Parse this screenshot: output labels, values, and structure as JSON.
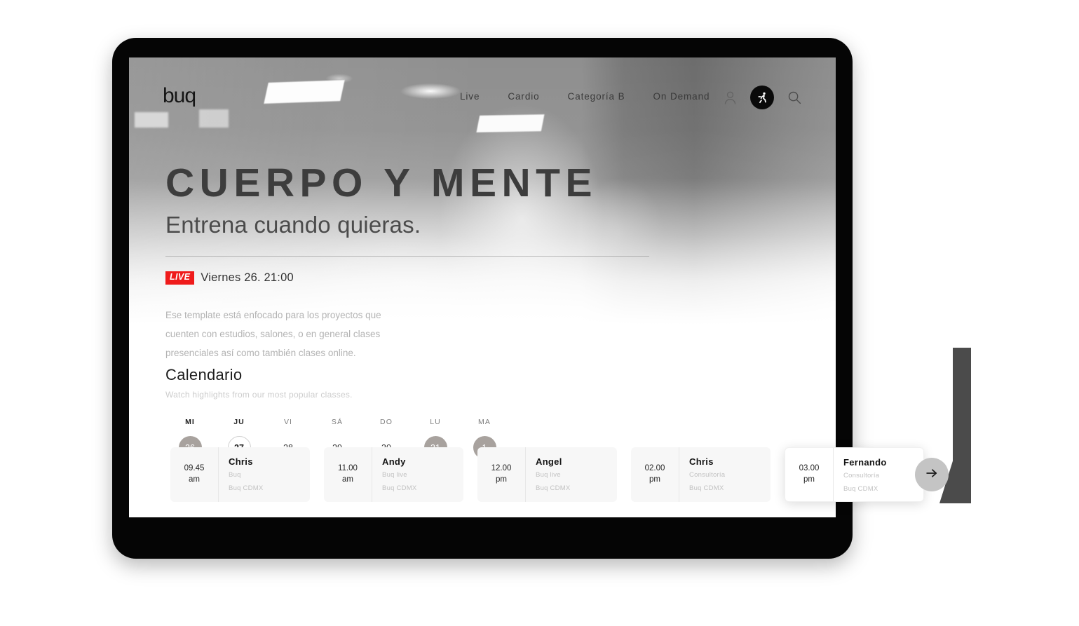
{
  "brand": {
    "logo_text": "buq"
  },
  "nav": {
    "links": [
      {
        "label": "Live"
      },
      {
        "label": "Cardio"
      },
      {
        "label": "Categoría B"
      },
      {
        "label": "On Demand"
      }
    ],
    "icons": {
      "account": "user-icon",
      "runner": "running-person-icon",
      "search": "search-icon"
    }
  },
  "hero": {
    "headline": "CUERPO Y MENTE",
    "subheadline": "Entrena cuando quieras.",
    "live_badge": "LIVE",
    "live_time": "Viernes 26. 21:00",
    "description": "Ese template está enfocado para los proyectos que cuenten con estudios, salones, o en general clases presenciales así como también clases online."
  },
  "calendar": {
    "title": "Calendario",
    "subtitle": "Watch highlights from our most popular classes.",
    "days": [
      {
        "dow": "MI",
        "num": "26",
        "style": "filled",
        "selected": false
      },
      {
        "dow": "JU",
        "num": "27",
        "style": "outline",
        "selected": true
      },
      {
        "dow": "VI",
        "num": "28",
        "style": "plain",
        "selected": false
      },
      {
        "dow": "SÁ",
        "num": "29",
        "style": "plain",
        "selected": false
      },
      {
        "dow": "DO",
        "num": "30",
        "style": "plain",
        "selected": false
      },
      {
        "dow": "LU",
        "num": "31",
        "style": "filled",
        "selected": false
      },
      {
        "dow": "MA",
        "num": "1",
        "style": "filled",
        "selected": false
      }
    ]
  },
  "classes": [
    {
      "time": "09.45",
      "meridiem": "am",
      "instructor": "Chris",
      "category": "Buq",
      "location": "Buq CDMX",
      "featured": false
    },
    {
      "time": "11.00",
      "meridiem": "am",
      "instructor": "Andy",
      "category": "Buq live",
      "location": "Buq CDMX",
      "featured": false
    },
    {
      "time": "12.00",
      "meridiem": "pm",
      "instructor": "Angel",
      "category": "Buq live",
      "location": "Buq CDMX",
      "featured": false
    },
    {
      "time": "02.00",
      "meridiem": "pm",
      "instructor": "Chris",
      "category": "Consultoría",
      "location": "Buq CDMX",
      "featured": false
    },
    {
      "time": "03.00",
      "meridiem": "pm",
      "instructor": "Fernando",
      "category": "Consultoría",
      "location": "Buq CDMX",
      "featured": true
    }
  ],
  "controls": {
    "next_label": "arrow-right-icon"
  },
  "colors": {
    "live_red": "#ef1b1b",
    "headline_gray": "#3d3d3d",
    "muted_text": "#c2c2c2",
    "day_filled": "#a8a29e",
    "card_bg": "#f7f7f7",
    "next_btn": "#c4c4c4",
    "deco_bar": "#4b4b4b",
    "frame_black": "#050505"
  }
}
